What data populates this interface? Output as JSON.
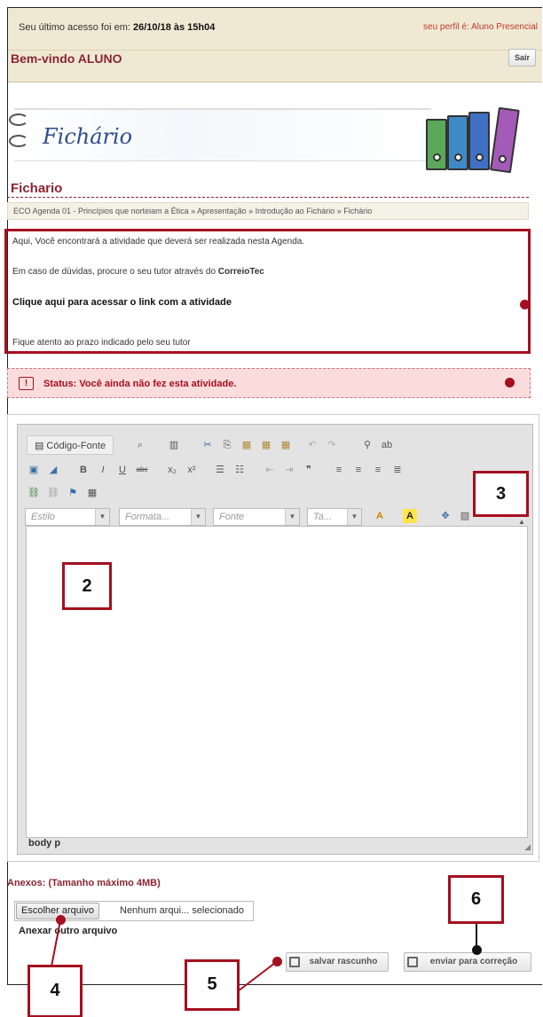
{
  "header": {
    "last_access_label": "Seu último acesso foi em:",
    "last_access_value": "26/10/18 às 15h04",
    "profile": "seu perfil é: Aluno Presencial",
    "welcome": "Bem-vindo ALUNO",
    "logout": "Sair"
  },
  "banner": {
    "title": "Fichário"
  },
  "page": {
    "title": "Fichario",
    "breadcrumb": "ECO Agenda 01 - Princípios que norteiam a Ética » Apresentação » Introdução ao Fichário » Fichário"
  },
  "intro": {
    "line1": "Aqui, Você encontrará a atividade que deverá ser realizada nesta Agenda.",
    "line2_prefix": "Em caso de dúvidas, procure o seu tutor através do ",
    "line2_link": "CorreioTec",
    "activity_link": "Clique aqui para acessar o link com a atividade",
    "line4": "Fique atento ao prazo indicado pelo seu tutor"
  },
  "status": {
    "icon": "!",
    "text": "Status: Você ainda não fez esta atividade."
  },
  "editor": {
    "source_button": "Código-Fonte",
    "combos": {
      "style": "Estilo",
      "format": "Formata...",
      "font": "Fonte",
      "size": "Ta..."
    },
    "path": "body  p",
    "icons": [
      "preview-icon",
      "templates-icon",
      "cut-icon",
      "copy-icon",
      "paste-icon",
      "paste-text-icon",
      "paste-word-icon",
      "undo-icon",
      "redo-icon",
      "find-icon",
      "replace-icon",
      "select-all-icon",
      "remove-format-icon",
      "bold-icon",
      "italic-icon",
      "underline-icon",
      "strike-icon",
      "subscript-icon",
      "superscript-icon",
      "numbered-list-icon",
      "bulleted-list-icon",
      "outdent-icon",
      "indent-icon",
      "blockquote-icon",
      "align-left-icon",
      "align-center-icon",
      "align-right-icon",
      "justify-icon",
      "link-icon",
      "unlink-icon",
      "anchor-icon",
      "table-icon",
      "text-color-icon",
      "bg-color-icon",
      "maximize-icon",
      "show-blocks-icon"
    ]
  },
  "attachments": {
    "title": "Anexos: (Tamanho máximo 4MB)",
    "choose_button": "Escolher arquivo",
    "no_file": "Nenhum arqui... selecionado",
    "add_another": "Anexar outro arquivo"
  },
  "actions": {
    "save_draft": "salvar rascunho",
    "submit": "enviar para correção"
  },
  "callouts": {
    "c2": "2",
    "c3": "3",
    "c4": "4",
    "c5": "5",
    "c6": "6"
  },
  "colors": {
    "accent": "#8a2432",
    "callout": "#a50f1f",
    "header_bg": "#efe9d4"
  }
}
